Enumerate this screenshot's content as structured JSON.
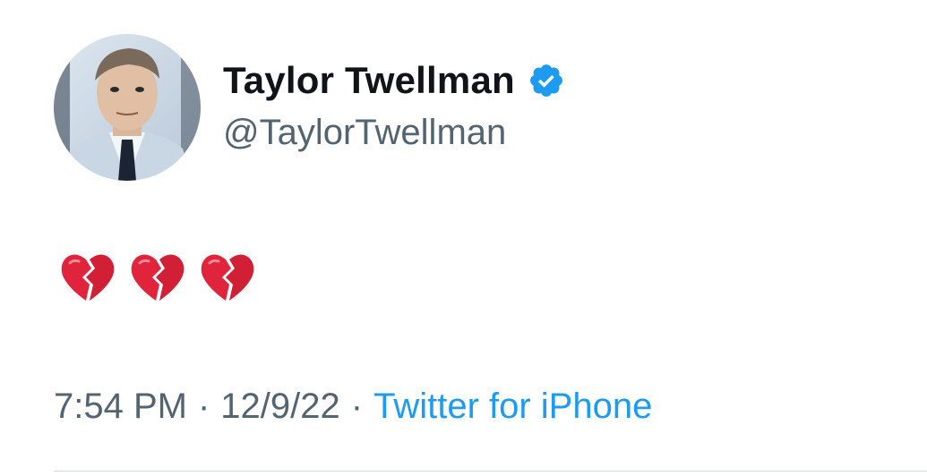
{
  "author": {
    "name": "Taylor Twellman",
    "handle": "@TaylorTwellman",
    "verified": true,
    "avatar": "profile-photo"
  },
  "tweet": {
    "text": "💔💔💔",
    "emoji_icons": [
      "broken-heart-icon",
      "broken-heart-icon",
      "broken-heart-icon"
    ]
  },
  "meta": {
    "time": "7:54 PM",
    "separator": "·",
    "date": "12/9/22",
    "source": "Twitter for iPhone"
  },
  "colors": {
    "text_primary": "#0f1419",
    "text_secondary": "#536471",
    "accent": "#1d9bf0",
    "heart": "#e0243c"
  }
}
